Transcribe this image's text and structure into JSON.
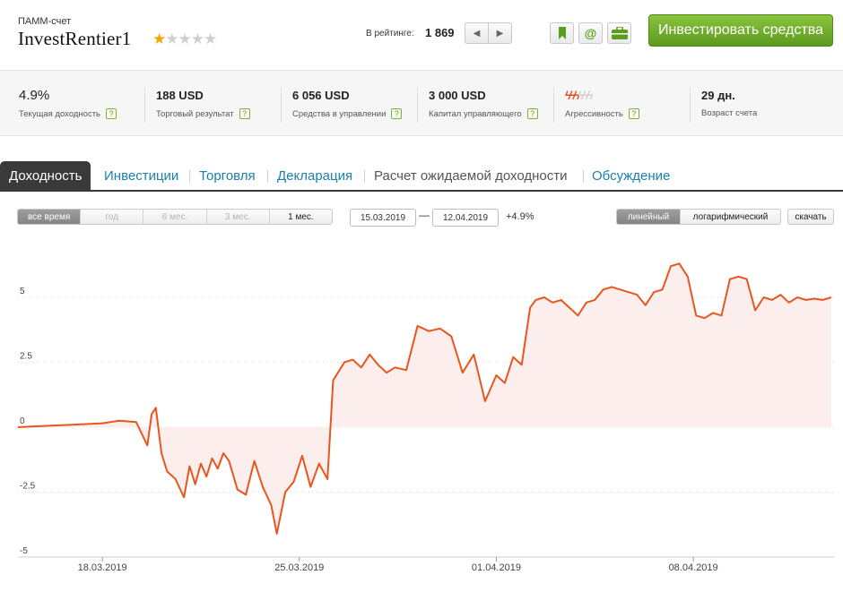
{
  "header": {
    "account_type": "ПАММ-счет",
    "account_name": "InvestRentier1",
    "rating_stars": 1,
    "rating_stars_max": 5,
    "rating_label": "В рейтинге:",
    "rating_value": "1 869",
    "pager_prev_icon": "chevron-left-icon",
    "pager_next_icon": "chevron-right-icon",
    "action_icons": [
      "bookmark-icon",
      "email-icon",
      "briefcase-icon"
    ],
    "invest_button_label": "Инвестировать средства",
    "invest_button_color": "#6fae2b"
  },
  "stats": [
    {
      "value": "4.9%",
      "label": "Текущая доходность",
      "help": "?"
    },
    {
      "value": "188 USD",
      "label": "Торговый результат",
      "help": "?"
    },
    {
      "value": "6 056 USD",
      "label": "Средства в управлении",
      "help": "?"
    },
    {
      "value": "3 000 USD",
      "label": "Капитал управляющего",
      "help": "?"
    },
    {
      "value_icons": 6,
      "value_icons_active": 3,
      "label": "Агрессивность",
      "help": "?"
    },
    {
      "value": "29 дн.",
      "label": "Возраст счета"
    }
  ],
  "tabs": [
    {
      "label": "Доходность",
      "active": true
    },
    {
      "label": "Инвестиции"
    },
    {
      "label": "Торговля"
    },
    {
      "label": "Декларация"
    },
    {
      "label": "Расчет ожидаемой доходности"
    },
    {
      "label": "Обсуждение"
    }
  ],
  "controls": {
    "ranges": [
      "все время",
      "год",
      "6 мес.",
      "3 мес.",
      "1 мес."
    ],
    "selected_range": "все время",
    "date_from": "15.03.2019",
    "date_separator": "—",
    "date_to": "12.04.2019",
    "change": "+4.9%",
    "scale_options": [
      "линейный",
      "логарифмический"
    ],
    "selected_scale": "линейный",
    "download_label": "скачать"
  },
  "chart_data": {
    "type": "area",
    "ylim": [
      -5,
      7
    ],
    "yticks": [
      5,
      2.5,
      0,
      -2.5,
      -5
    ],
    "ytick_labels": [
      "5",
      "2.5",
      "0",
      "-2.5",
      "-5"
    ],
    "xticks": [
      "18.03.2019",
      "25.03.2019",
      "01.04.2019",
      "08.04.2019"
    ],
    "xtick_values": [
      3,
      10,
      17,
      24
    ],
    "xlim": [
      0,
      29
    ],
    "grid": true,
    "line_color": "#e8561e",
    "fill_color": "#fdeeee",
    "x": [
      0,
      1,
      2,
      3,
      3.6,
      4.2,
      4.6,
      4.75,
      4.9,
      5.1,
      5.3,
      5.6,
      5.9,
      6.1,
      6.3,
      6.5,
      6.7,
      6.9,
      7.1,
      7.3,
      7.5,
      7.8,
      8.1,
      8.4,
      8.7,
      9.0,
      9.2,
      9.5,
      9.8,
      10.1,
      10.4,
      10.7,
      11.0,
      11.2,
      11.6,
      11.9,
      12.2,
      12.5,
      12.8,
      13.1,
      13.4,
      13.8,
      14.2,
      14.6,
      15.0,
      15.4,
      15.8,
      16.2,
      16.6,
      17.0,
      17.3,
      17.6,
      17.9,
      18.2,
      18.4,
      18.7,
      19.0,
      19.3,
      19.6,
      19.9,
      20.2,
      20.5,
      20.8,
      21.1,
      21.4,
      21.7,
      22.0,
      22.3,
      22.6,
      22.9,
      23.2,
      23.5,
      23.8,
      24.1,
      24.4,
      24.7,
      25.0,
      25.3,
      25.6,
      25.9,
      26.2,
      26.5,
      26.8,
      27.1,
      27.4,
      27.7,
      28.0,
      28.3,
      28.6,
      28.9
    ],
    "values": [
      0.0,
      0.05,
      0.1,
      0.15,
      0.25,
      0.2,
      -0.7,
      0.5,
      0.75,
      -1.0,
      -1.7,
      -2.0,
      -2.7,
      -1.5,
      -2.2,
      -1.4,
      -1.9,
      -1.2,
      -1.6,
      -1.0,
      -1.3,
      -2.4,
      -2.6,
      -1.3,
      -2.3,
      -3.0,
      -4.1,
      -2.5,
      -2.1,
      -1.1,
      -2.3,
      -1.4,
      -2.0,
      1.8,
      2.5,
      2.6,
      2.3,
      2.8,
      2.4,
      2.1,
      2.3,
      2.2,
      3.9,
      3.7,
      3.8,
      3.5,
      2.1,
      2.8,
      1.0,
      2.0,
      1.7,
      2.7,
      2.4,
      4.6,
      4.9,
      5.0,
      4.8,
      4.9,
      4.6,
      4.3,
      4.8,
      4.9,
      5.3,
      5.4,
      5.3,
      5.2,
      5.1,
      4.7,
      5.2,
      5.3,
      6.2,
      6.3,
      5.8,
      4.3,
      4.2,
      4.4,
      4.3,
      5.7,
      5.8,
      5.7,
      4.5,
      5.0,
      4.9,
      5.1,
      4.8,
      5.0,
      4.9,
      4.95,
      4.9,
      5.0
    ]
  }
}
